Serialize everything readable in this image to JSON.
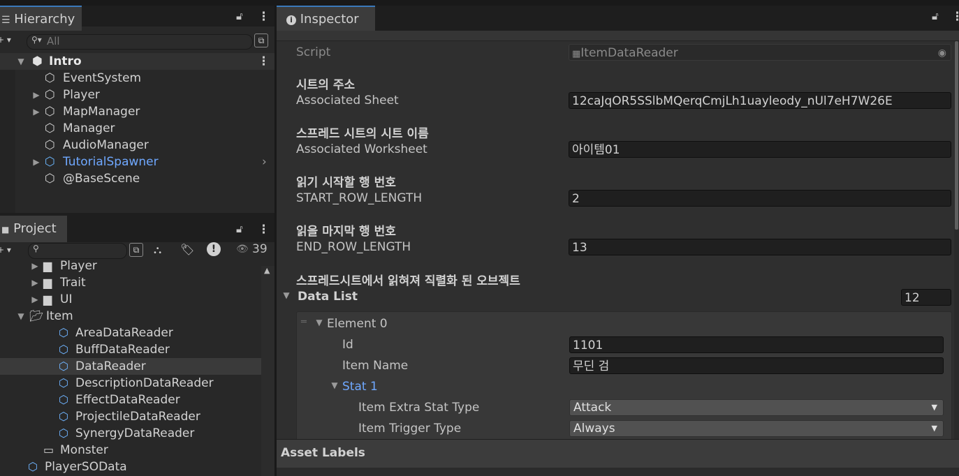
{
  "hierarchy": {
    "tab_label": "Hierarchy",
    "search_placeholder": "All",
    "scene_name": "Intro",
    "items": [
      {
        "label": "EventSystem",
        "expandable": false,
        "selected": false
      },
      {
        "label": "Player",
        "expandable": true,
        "selected": false
      },
      {
        "label": "MapManager",
        "expandable": true,
        "selected": false
      },
      {
        "label": "Manager",
        "expandable": false,
        "selected": false
      },
      {
        "label": "AudioManager",
        "expandable": false,
        "selected": false
      },
      {
        "label": "TutorialSpawner",
        "expandable": true,
        "selected": true
      },
      {
        "label": "@BaseScene",
        "expandable": false,
        "selected": false
      }
    ]
  },
  "project": {
    "tab_label": "Project",
    "hidden_count": "39",
    "tree": [
      {
        "label": "Player",
        "type": "folder"
      },
      {
        "label": "Trait",
        "type": "folder"
      },
      {
        "label": "UI",
        "type": "folder"
      },
      {
        "label": "Item",
        "type": "folder-open"
      },
      {
        "label": "AreaDataReader",
        "type": "script"
      },
      {
        "label": "BuffDataReader",
        "type": "script"
      },
      {
        "label": "DataReader",
        "type": "script"
      },
      {
        "label": "DescriptionDataReader",
        "type": "script"
      },
      {
        "label": "EffectDataReader",
        "type": "script"
      },
      {
        "label": "ProjectileDataReader",
        "type": "script"
      },
      {
        "label": "SynergyDataReader",
        "type": "script"
      },
      {
        "label": "Monster",
        "type": "folder-empty"
      },
      {
        "label": "PlayerSOData",
        "type": "script"
      }
    ]
  },
  "inspector": {
    "tab_label": "Inspector",
    "script_label": "Script",
    "script_value": "ItemDataReader",
    "sections": [
      {
        "header": "시트의 주소",
        "label": "Associated Sheet",
        "value": "12caJqOR5SSlbMQerqCmjLh1uayleody_nUl7eH7W26E"
      },
      {
        "header": "스프레드 시트의 시트 이름",
        "label": "Associated Worksheet",
        "value": "아이템01"
      },
      {
        "header": "읽기 시작할 행 번호",
        "label": "START_ROW_LENGTH",
        "value": "2"
      },
      {
        "header": "읽을 마지막 행 번호",
        "label": "END_ROW_LENGTH",
        "value": "13"
      }
    ],
    "list_header": "스프레드시트에서 읽혀져 직렬화 된 오브젝트",
    "list_label": "Data List",
    "list_count": "12",
    "element_label": "Element 0",
    "id_label": "Id",
    "id_value": "1101",
    "name_label": "Item Name",
    "name_value": "무딘 검",
    "stat_label": "Stat 1",
    "stat_type_label": "Item Extra Stat Type",
    "stat_type_value": "Attack",
    "trigger_label": "Item Trigger Type",
    "trigger_value": "Always",
    "asset_labels": "Asset Labels"
  },
  "colors": {
    "selection": "#2c5d87",
    "accent_blue": "#6fa8ff",
    "panel": "#282828"
  }
}
